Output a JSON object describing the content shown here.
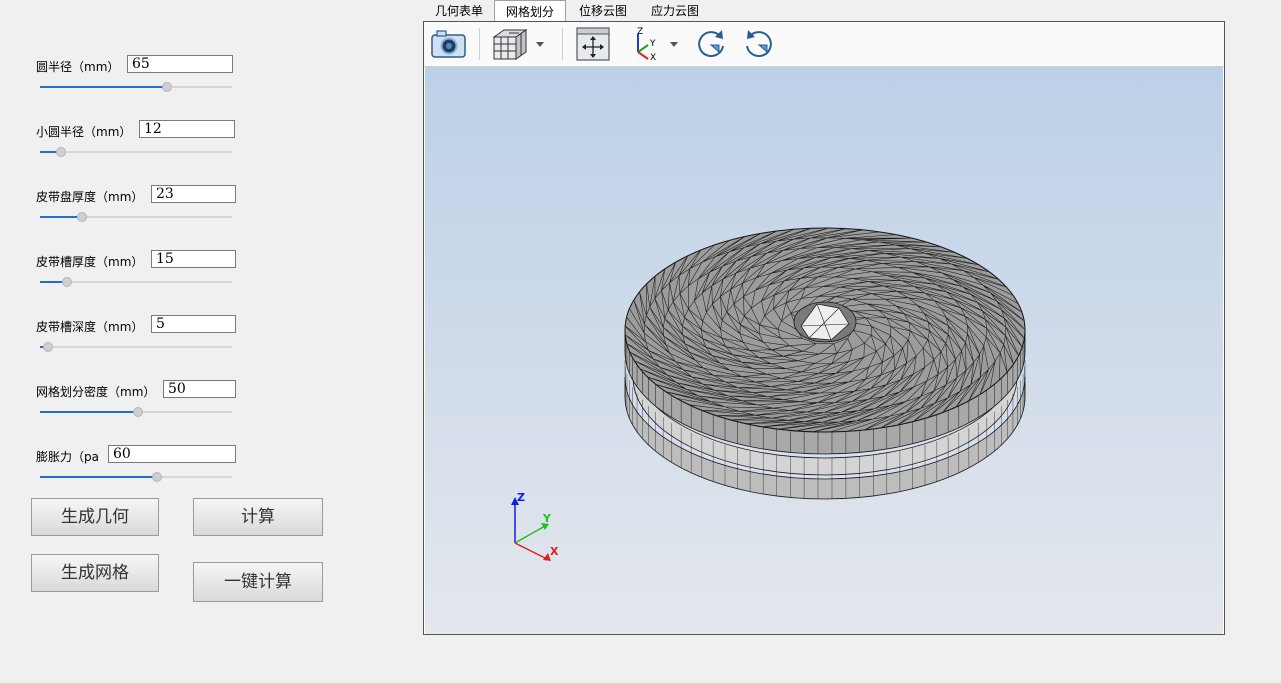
{
  "params": [
    {
      "label": "圆半径（mm）",
      "value": "65",
      "slider": 0.66
    },
    {
      "label": "小圆半径（mm）",
      "value": "12",
      "slider": 0.11
    },
    {
      "label": "皮带盘厚度（mm）",
      "value": "23",
      "slider": 0.22
    },
    {
      "label": "皮带槽厚度（mm）",
      "value": "15",
      "slider": 0.14
    },
    {
      "label": "皮带槽深度（mm）",
      "value": "5",
      "slider": 0.04
    },
    {
      "label": "网格划分密度（mm）",
      "value": "50",
      "slider": 0.51
    },
    {
      "label": "膨胀力（pa",
      "value": "60",
      "slider": 0.61
    }
  ],
  "buttons": {
    "generate_geometry": "生成几何",
    "compute": "计算",
    "generate_mesh": "生成网格",
    "one_click_compute": "一键计算"
  },
  "tabs": [
    "几何表单",
    "网格划分",
    "位移云图",
    "应力云图"
  ],
  "active_tab": "网格划分",
  "toolbar": {
    "icons": [
      "camera-icon",
      "view-cube-icon",
      "fit-view-icon",
      "axis-icon",
      "rotate-clockwise-icon",
      "rotate-counterclockwise-icon"
    ]
  },
  "triad": {
    "x": "X",
    "y": "Y",
    "z": "Z"
  },
  "colors": {
    "slider_fill": "#1f6fcf",
    "mesh_face": "#9c9c9c",
    "mesh_line": "#1a1a1a",
    "axis_x": "#e02020",
    "axis_y": "#20c020",
    "axis_z": "#1020e0"
  }
}
